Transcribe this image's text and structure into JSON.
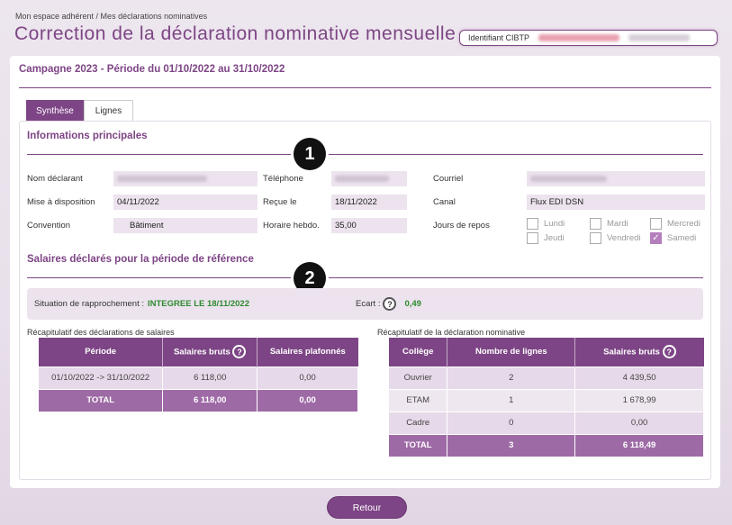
{
  "breadcrumb": "Mon espace adhérent / Mes déclarations nominatives",
  "page_title": "Correction de la déclaration nominative mensuelle",
  "identifiant_label": "Identifiant CIBTP",
  "campaign_title": "Campagne 2023 - Période du 01/10/2022 au 31/10/2022",
  "tabs": [
    {
      "label": "Synthèse",
      "active": true
    },
    {
      "label": "Lignes",
      "active": false
    }
  ],
  "section1": {
    "title": "Informations principales",
    "marker": "1",
    "fields": {
      "nom_declarant_label": "Nom déclarant",
      "telephone_label": "Téléphone",
      "courriel_label": "Courriel",
      "mise_dispo_label": "Mise à disposition",
      "mise_dispo_value": "04/11/2022",
      "recue_le_label": "Reçue le",
      "recue_le_value": "18/11/2022",
      "canal_label": "Canal",
      "canal_value": "Flux EDI DSN",
      "convention_label": "Convention",
      "convention_value": "Bâtiment",
      "horaire_label": "Horaire hebdo.",
      "horaire_value": "35,00",
      "jours_repos_label": "Jours de repos"
    },
    "days": [
      {
        "label": "Lundi",
        "checked": false
      },
      {
        "label": "Mardi",
        "checked": false
      },
      {
        "label": "Mercredi",
        "checked": false
      },
      {
        "label": "Jeudi",
        "checked": false
      },
      {
        "label": "Vendredi",
        "checked": false
      },
      {
        "label": "Samedi",
        "checked": true
      }
    ]
  },
  "section2": {
    "title": "Salaires déclarés pour la période de référence",
    "marker": "2",
    "rapprochement_label": "Situation de rapprochement :",
    "rapprochement_value": "INTEGREE LE 18/11/2022",
    "ecart_label": "Ecart :",
    "ecart_value": "0,49"
  },
  "recap_salaires": {
    "caption": "Récapitulatif des déclarations de salaires",
    "headers": [
      "Période",
      "Salaires bruts",
      "Salaires plafonnés"
    ],
    "rows": [
      [
        "01/10/2022 -> 31/10/2022",
        "6 118,00",
        "0,00"
      ]
    ],
    "total": [
      "TOTAL",
      "6 118,00",
      "0,00"
    ]
  },
  "recap_nominative": {
    "caption": "Récapitulatif de la déclaration nominative",
    "headers": [
      "Collège",
      "Nombre de lignes",
      "Salaires bruts"
    ],
    "rows": [
      [
        "Ouvrier",
        "2",
        "4 439,50"
      ],
      [
        "ETAM",
        "1",
        "1 678,99"
      ],
      [
        "Cadre",
        "0",
        "0,00"
      ]
    ],
    "total": [
      "TOTAL",
      "3",
      "6 118,49"
    ]
  },
  "help_glyph": "?",
  "check_glyph": "✓",
  "retour_label": "Retour",
  "colors": {
    "accent": "#7d4585",
    "field_bg": "#ece3ee",
    "green": "#2e8a2e"
  }
}
